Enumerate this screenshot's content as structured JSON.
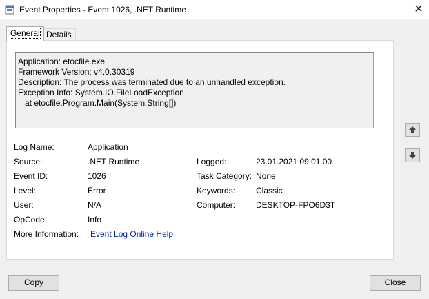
{
  "window": {
    "title": "Event Properties - Event 1026, .NET Runtime",
    "icon": "event-viewer-icon",
    "close_glyph": "✕"
  },
  "tabs": [
    {
      "label": "General",
      "selected": true
    },
    {
      "label": "Details",
      "selected": false
    }
  ],
  "description": {
    "lines": [
      "Application: etocfile.exe",
      "Framework Version: v4.0.30319",
      "Description: The process was terminated due to an unhandled exception.",
      "Exception Info: System.IO.FileLoadException",
      "   at etocfile.Program.Main(System.String[])"
    ]
  },
  "fields": {
    "log_name": {
      "label": "Log Name:",
      "value": "Application"
    },
    "source": {
      "label": "Source:",
      "value": ".NET Runtime"
    },
    "logged": {
      "label": "Logged:",
      "value": "23.01.2021 09.01.00"
    },
    "event_id": {
      "label": "Event ID:",
      "value": "1026"
    },
    "task_category": {
      "label": "Task Category:",
      "value": "None"
    },
    "level": {
      "label": "Level:",
      "value": "Error"
    },
    "keywords": {
      "label": "Keywords:",
      "value": "Classic"
    },
    "user": {
      "label": "User:",
      "value": "N/A"
    },
    "computer": {
      "label": "Computer:",
      "value": "DESKTOP-FPO6D3T"
    },
    "opcode": {
      "label": "OpCode:",
      "value": "Info"
    },
    "more_info": {
      "label": "More Information:",
      "link": "Event Log Online Help"
    }
  },
  "nav": {
    "up_icon": "arrow-up-icon",
    "down_icon": "arrow-down-icon"
  },
  "buttons": {
    "copy": "Copy",
    "close": "Close"
  }
}
